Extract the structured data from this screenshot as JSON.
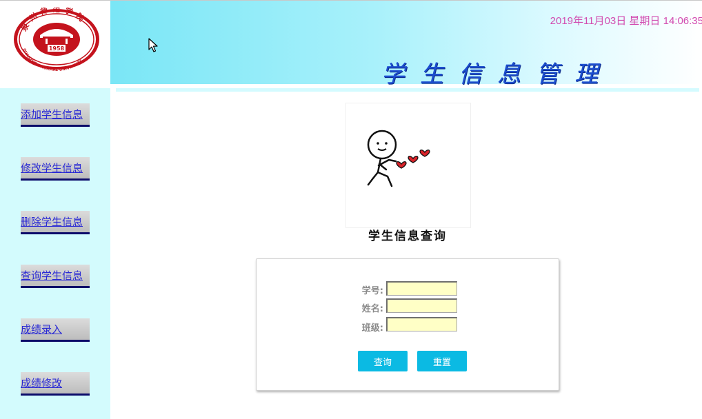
{
  "header": {
    "datetime": "2019年11月03日 星期日 14:06:35",
    "site_title": "学生信息管理",
    "logo": {
      "icon": "university-seal-icon",
      "arc_text": "泉州师范学院",
      "year": "1958",
      "english_text": "QUANZHOU NORMAL UNIVERSITY"
    }
  },
  "sidebar": {
    "items": [
      {
        "label": "添加学生信息"
      },
      {
        "label": "修改学生信息"
      },
      {
        "label": "删除学生信息"
      },
      {
        "label": "查询学生信息"
      },
      {
        "label": "成绩录入"
      },
      {
        "label": "成绩修改"
      }
    ]
  },
  "main": {
    "illustration": "stick-figure-hearts-icon",
    "query_title": "学生信息查询",
    "form": {
      "student_id": {
        "label": "学号:",
        "value": "",
        "placeholder": ""
      },
      "name": {
        "label": "姓名:",
        "value": "",
        "placeholder": ""
      },
      "class": {
        "label": "班级:",
        "value": "",
        "placeholder": ""
      },
      "query_button": "查询",
      "reset_button": "重置"
    }
  },
  "colors": {
    "datetime": "#d24bb0",
    "title": "#1d4fd0",
    "sidebar_bg": "#d3fbfd",
    "button": "#0bbae3",
    "input_bg": "#ffffc6",
    "seal_red": "#c4131d"
  }
}
